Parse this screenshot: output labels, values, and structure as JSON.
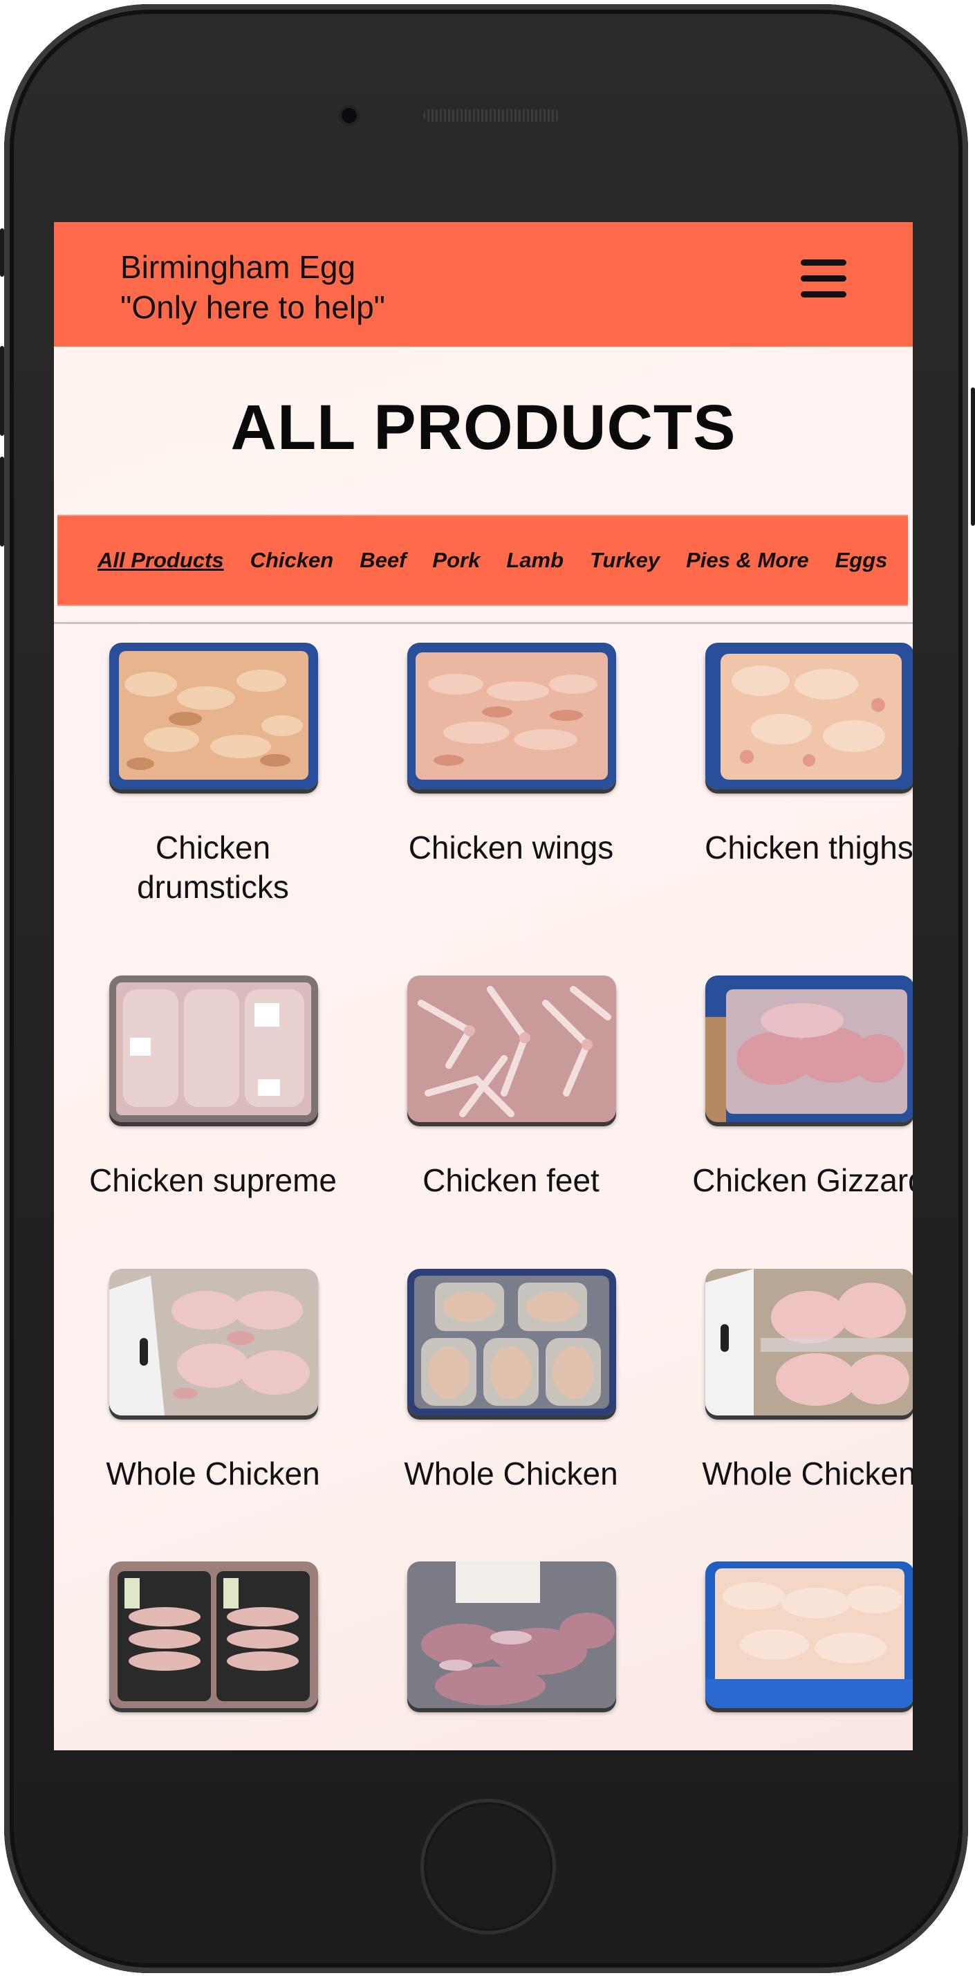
{
  "header": {
    "brand_name": "Birmingham Egg",
    "tagline": "\"Only here to help\""
  },
  "page_title": "ALL PRODUCTS",
  "categories": [
    {
      "label": "All Products",
      "active": true
    },
    {
      "label": "Chicken",
      "active": false
    },
    {
      "label": "Beef",
      "active": false
    },
    {
      "label": "Pork",
      "active": false
    },
    {
      "label": "Lamb",
      "active": false
    },
    {
      "label": "Turkey",
      "active": false
    },
    {
      "label": "Pies & More",
      "active": false
    },
    {
      "label": "Eggs",
      "active": false
    }
  ],
  "products": [
    {
      "name": "Chicken drumsticks",
      "image": "drumsticks-blue-crate-photo"
    },
    {
      "name": "Chicken wings",
      "image": "wings-blue-crate-photo"
    },
    {
      "name": "Chicken thighs",
      "image": "thighs-blue-crate-photo"
    },
    {
      "name": "Chicken supreme",
      "image": "supreme-packed-photo"
    },
    {
      "name": "Chicken feet",
      "image": "feet-photo"
    },
    {
      "name": "Chicken Gizzard",
      "image": "gizzard-box-photo"
    },
    {
      "name": "Whole Chicken",
      "image": "whole-chicken-box-photo"
    },
    {
      "name": "Whole Chicken",
      "image": "whole-chicken-trays-photo"
    },
    {
      "name": "Whole Chicken",
      "image": "whole-chicken-bagged-photo"
    },
    {
      "name": "",
      "image": "breast-trays-photo"
    },
    {
      "name": "",
      "image": "gizzards-labelled-photo"
    },
    {
      "name": "",
      "image": "legs-blue-crate-photo"
    }
  ],
  "colors": {
    "accent": "#ff6b4a",
    "background": "#fff4f0",
    "text": "#111111"
  }
}
